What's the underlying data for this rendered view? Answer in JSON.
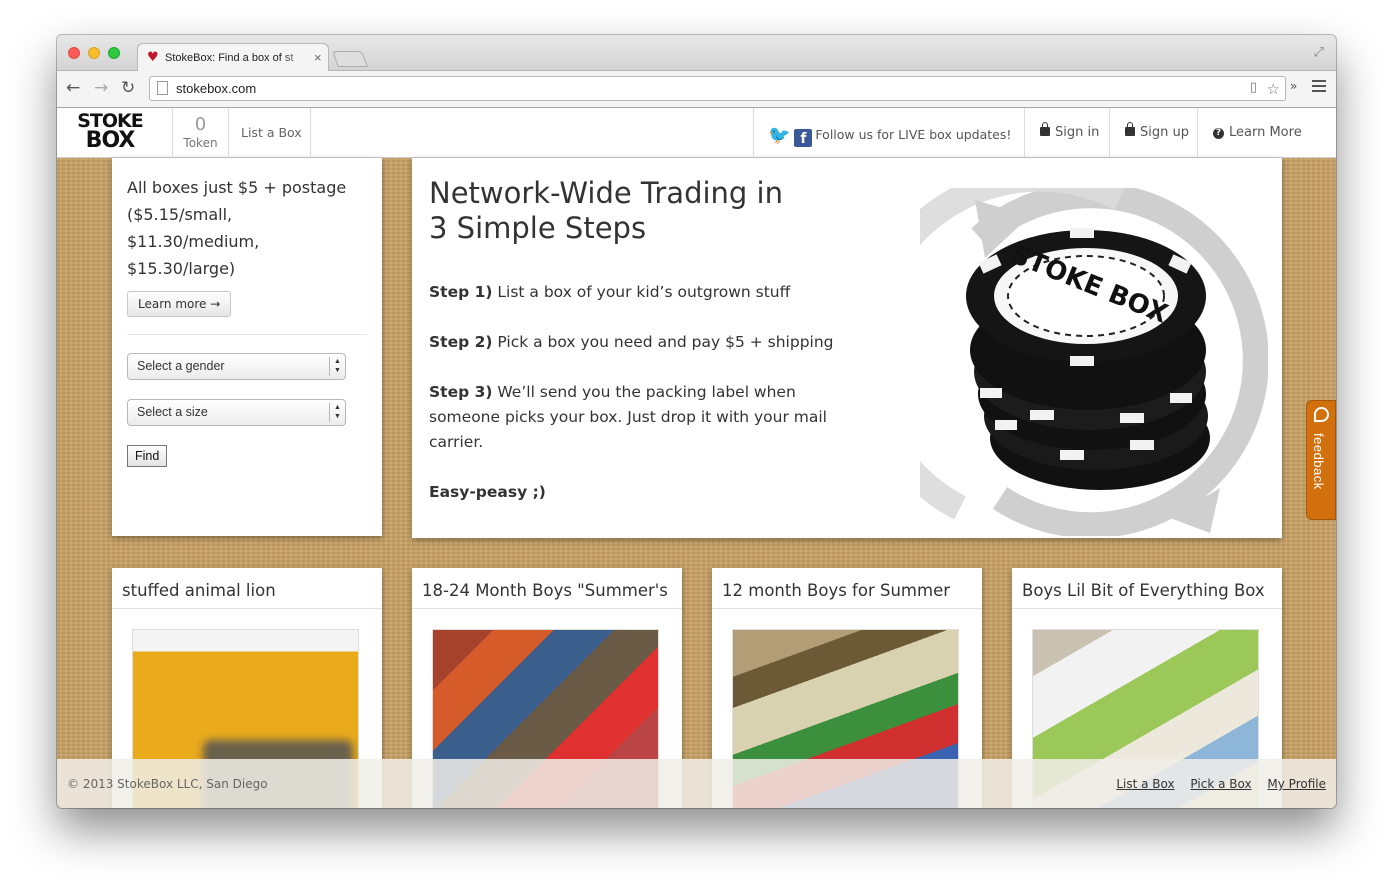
{
  "browser": {
    "tab_title": "StokeBox: Find a box of st",
    "url": "stokebox.com"
  },
  "navbar": {
    "logo_line1": "STOKE",
    "logo_line2": "BOX",
    "token_count": "0",
    "token_label": "Token",
    "list_box": "List a Box",
    "follow_text": "Follow us for LIVE box updates!",
    "sign_in": "Sign in",
    "sign_up": "Sign up",
    "learn_more": "Learn More"
  },
  "search": {
    "promo": "All boxes just $5 + postage ($5.15/small, $11.30/medium, $15.30/large)",
    "learn_more_button": "Learn more →",
    "gender_select": "Select a gender",
    "size_select": "Select a size",
    "find_button": "Find"
  },
  "hero": {
    "title_line1": "Network-Wide Trading in",
    "title_line2": "3 Simple Steps",
    "steps": [
      {
        "label": "Step 1)",
        "text": "List a box of your kid’s outgrown stuff"
      },
      {
        "label": "Step 2)",
        "text": "Pick a box you need and pay $5 + shipping"
      },
      {
        "label": "Step 3)",
        "text": "We’ll send you the packing label when someone picks your box.  Just drop it with your mail carrier."
      }
    ],
    "closing": "Easy-peasy ;)",
    "chip_text": "STOKE BOX"
  },
  "feedback": {
    "label": "feedback"
  },
  "boxes": [
    {
      "title": "stuffed animal lion"
    },
    {
      "title": "18-24 Month Boys \"Summer's"
    },
    {
      "title": "12 month Boys for Summer"
    },
    {
      "title": "Boys Lil Bit of Everything Box"
    }
  ],
  "footer": {
    "copyright": "© 2013 StokeBox LLC, San Diego",
    "links": [
      "List a Box",
      "Pick a Box",
      "My Profile"
    ]
  },
  "colors": {
    "brand_red": "#c0172b",
    "feedback_orange": "#d3700e",
    "twitter_blue": "#2aa9e0",
    "facebook_blue": "#3b5998"
  }
}
